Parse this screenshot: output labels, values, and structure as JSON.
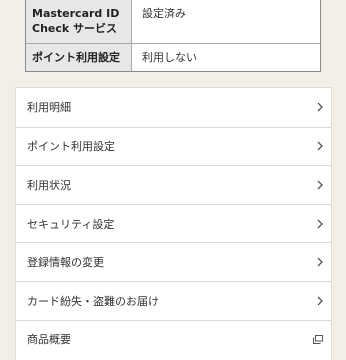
{
  "settings_table": {
    "rows": [
      {
        "key": "Mastercard ID Check サービス",
        "value": "設定済み"
      },
      {
        "key": "ポイント利用設定",
        "value": "利用しない"
      }
    ]
  },
  "menu": {
    "items": [
      {
        "label": "利用明細",
        "icon": "chevron-right-icon"
      },
      {
        "label": "ポイント利用設定",
        "icon": "chevron-right-icon"
      },
      {
        "label": "利用状況",
        "icon": "chevron-right-icon"
      },
      {
        "label": "セキュリティ設定",
        "icon": "chevron-right-icon"
      },
      {
        "label": "登録情報の変更",
        "icon": "chevron-right-icon"
      },
      {
        "label": "カード紛失・盗難のお届け",
        "icon": "chevron-right-icon"
      },
      {
        "label": "商品概要",
        "icon": "external-link-icon"
      }
    ]
  },
  "colors": {
    "background": "#f3efe7",
    "card": "#ffffff",
    "header_cell": "#e7e7e7",
    "text": "#333333",
    "icon": "#555555"
  }
}
